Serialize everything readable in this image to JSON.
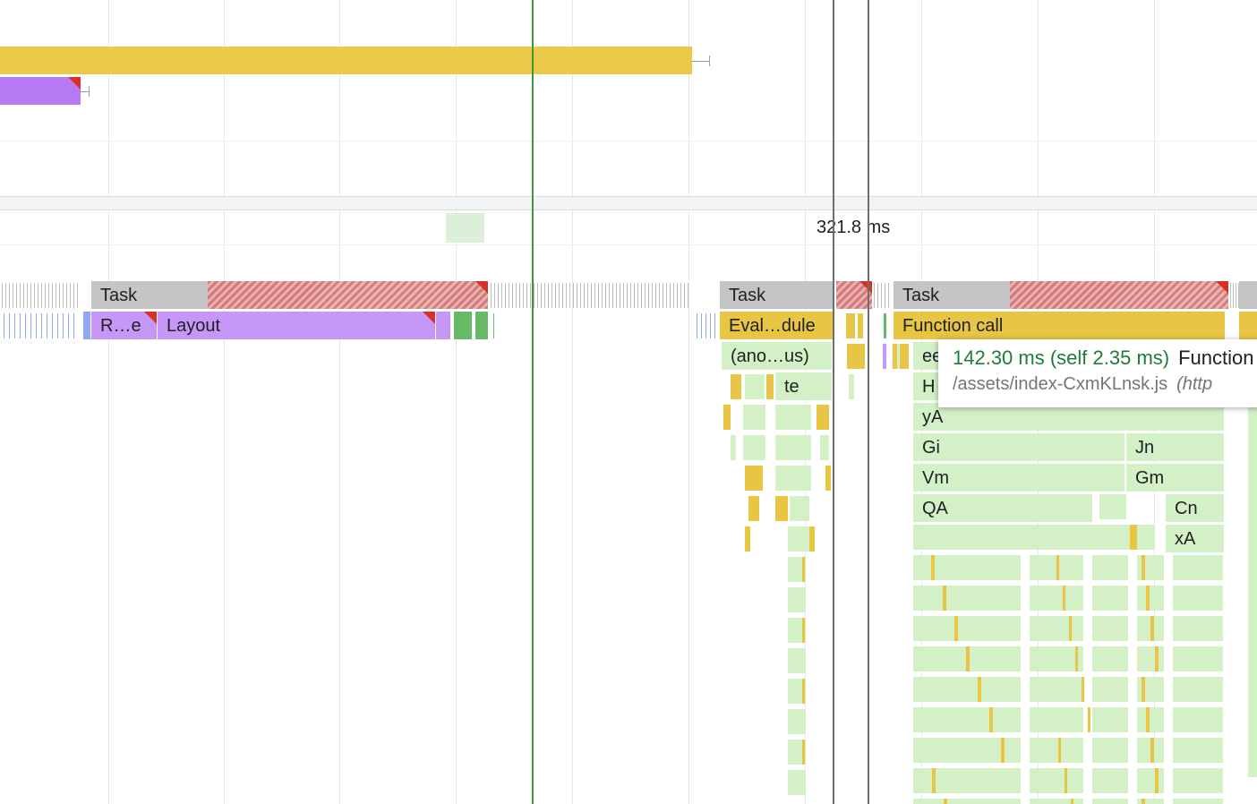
{
  "measurement": {
    "duration_label": "321.8 ms"
  },
  "main_thread": {
    "tasks": [
      {
        "label": "Task"
      },
      {
        "label": "Task"
      },
      {
        "label": "Task"
      }
    ],
    "events": {
      "recalc_style": "R…e",
      "layout": "Layout",
      "evaluate_module": "Eval…dule",
      "anonymous": "(ano…us)",
      "te": "te",
      "function_call": "Function call",
      "ee": "ee",
      "h": "H",
      "ya": "yA",
      "gi": "Gi",
      "jn": "Jn",
      "vm": "Vm",
      "gm": "Gm",
      "qa": "QA",
      "cn": "Cn",
      "xa": "xA"
    }
  },
  "tooltip": {
    "time": "142.30 ms (self 2.35 ms)",
    "name": "Function call",
    "url": "/assets/index-CxmKLnsk.js",
    "url_suffix": "(http"
  },
  "colors": {
    "scripting": "#e8c545",
    "rendering": "#c797f7",
    "task": "#c5c5c5",
    "js_frame": "#d3f0c6",
    "long_task_stripe": "#d67a7a",
    "warning_triangle": "#d93025",
    "marker_green": "#3c9a3c",
    "marker_gray": "#6e6e6e"
  }
}
